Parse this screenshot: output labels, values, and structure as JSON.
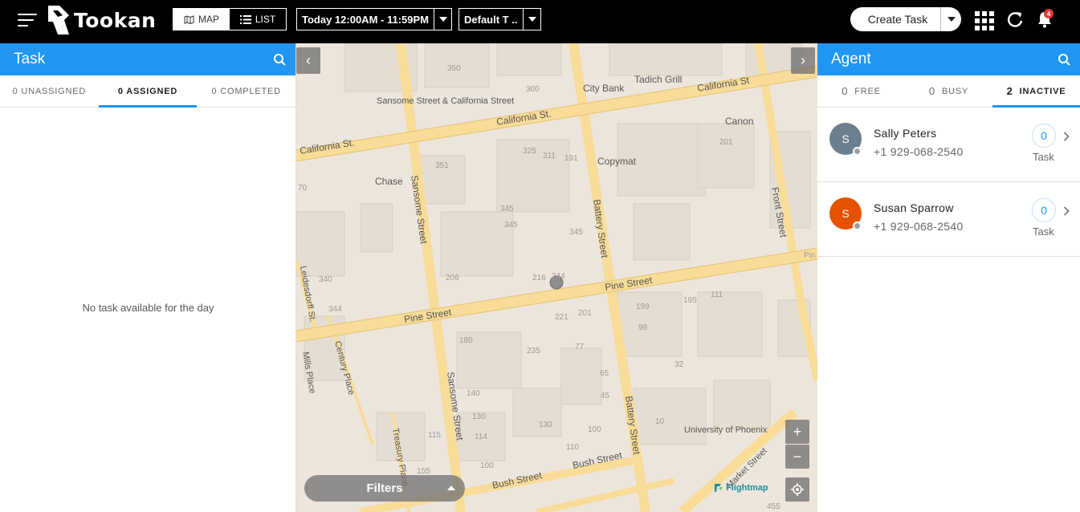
{
  "header": {
    "logo_text": "Tookan",
    "view_map": "MAP",
    "view_list": "LIST",
    "date_range": "Today 12:00AM - 11:59PM",
    "team_filter": "Default T ..",
    "create_task": "Create Task",
    "notification_count": "4"
  },
  "task_panel": {
    "title": "Task",
    "tabs": [
      {
        "label": "0 UNASSIGNED"
      },
      {
        "label": "0 ASSIGNED"
      },
      {
        "label": "0 COMPLETED"
      }
    ],
    "active_tab": "0 ASSIGNED",
    "empty_message": "No task available for the day"
  },
  "map": {
    "filters_label": "Filters",
    "attribution": "Flightmap",
    "streets": [
      "California St.",
      "California St.",
      "California St",
      "Sansome Street",
      "Battery Street",
      "Pine Street",
      "Pine Street",
      "Front Street",
      "Leidesdorff St.",
      "Century Place",
      "Mills Place",
      "Treasury Place",
      "Bush Street",
      "Bush Street",
      "Market Street",
      "Sansome Street",
      "Battery Street"
    ],
    "places": [
      "Sansome Street & California Street",
      "City Bank",
      "Tadich Grill",
      "Canon",
      "Copymat",
      "Chase",
      "University of Phoenix"
    ],
    "numbers": [
      "350",
      "300",
      "325",
      "311",
      "191",
      "351",
      "201",
      "345",
      "345",
      "345",
      "206",
      "216",
      "244",
      "340",
      "344",
      "221",
      "201",
      "199",
      "195",
      "111",
      "98",
      "180",
      "235",
      "77",
      "65",
      "32",
      "140",
      "45",
      "130",
      "114",
      "130",
      "100",
      "110",
      "100",
      "115",
      "10",
      "155",
      "455",
      "70",
      "Pin"
    ],
    "zoom_in": "+",
    "zoom_out": "−"
  },
  "agent_panel": {
    "title": "Agent",
    "tabs": [
      {
        "count": "0",
        "label": "FREE"
      },
      {
        "count": "0",
        "label": "BUSY"
      },
      {
        "count": "2",
        "label": "INACTIVE"
      }
    ],
    "active_tab": "INACTIVE",
    "agents": [
      {
        "initial": "S",
        "name": "Sally Peters",
        "phone": "+1 929-068-2540",
        "task_count": "0",
        "task_label": "Task",
        "avatar_color": "#6b7f8e"
      },
      {
        "initial": "S",
        "name": "Susan Sparrow",
        "phone": "+1 929-068-2540",
        "task_count": "0",
        "task_label": "Task",
        "avatar_color": "#e65100"
      }
    ]
  },
  "colors": {
    "accent": "#2196f3",
    "topbar": "#000000"
  }
}
